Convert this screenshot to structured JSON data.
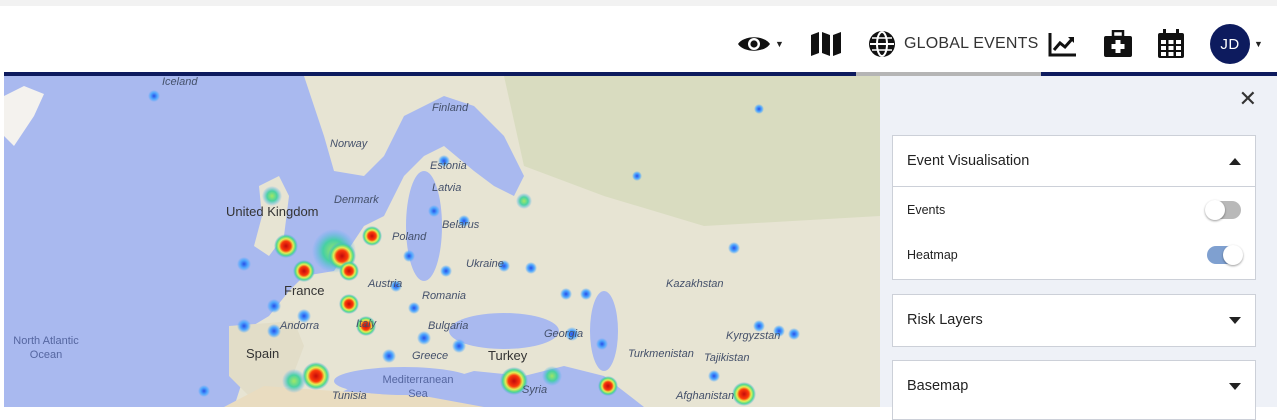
{
  "header": {
    "global_events_label": "GLOBAL EVENTS",
    "user_initials": "JD",
    "accent_color": "#0d1b5e",
    "icons": [
      "eye-icon",
      "map-icon",
      "globe-icon",
      "chart-icon",
      "medical-kit-icon",
      "calendar-icon"
    ]
  },
  "map": {
    "labels": {
      "iceland": "Iceland",
      "finland": "Finland",
      "norway": "Norway",
      "estonia": "Estonia",
      "latvia": "Latvia",
      "denmark": "Denmark",
      "united_kingdom": "United Kingdom",
      "poland": "Poland",
      "belarus": "Belarus",
      "ukraine": "Ukraine",
      "kazakhstan": "Kazakhstan",
      "france": "France",
      "austria": "Austria",
      "romania": "Romania",
      "andorra": "Andorra",
      "italy": "Italy",
      "bulgaria": "Bulgaria",
      "georgia": "Georgia",
      "kyrgyzstan": "Kyrgyzstan",
      "north_atlantic_ocean": "North Atlantic Ocean",
      "spain": "Spain",
      "greece": "Greece",
      "turkey": "Turkey",
      "turkmenistan": "Turkmenistan",
      "tajikistan": "Tajikistan",
      "mediterranean_sea": "Mediterranean Sea",
      "tunisia": "Tunisia",
      "syria": "Syria",
      "afghanistan": "Afghanistan"
    }
  },
  "panel": {
    "event_visualisation": {
      "title": "Event Visualisation",
      "options": [
        {
          "label": "Events",
          "enabled": false
        },
        {
          "label": "Heatmap",
          "enabled": true
        }
      ]
    },
    "risk_layers": {
      "title": "Risk Layers"
    },
    "basemap": {
      "title": "Basemap"
    }
  }
}
